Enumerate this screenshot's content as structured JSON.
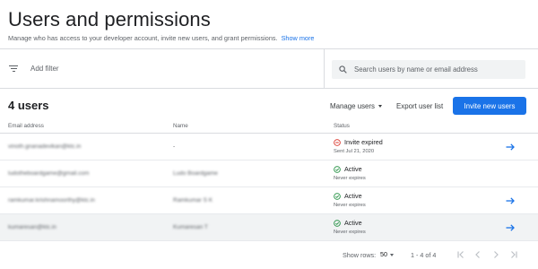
{
  "header": {
    "title": "Users and permissions",
    "subtitle": "Manage who has access to your developer account, invite new users, and grant permissions.",
    "show_more": "Show more"
  },
  "filter": {
    "label": "Add filter",
    "icon": "filter-icon"
  },
  "search": {
    "placeholder": "Search users by name or email address",
    "icon": "search-icon"
  },
  "users": {
    "count_label": "4 users",
    "manage_users": "Manage users",
    "export": "Export user list",
    "invite": "Invite new users"
  },
  "table": {
    "columns": [
      "Email address",
      "Name",
      "Status"
    ],
    "rows": [
      {
        "email": "vinoth.gnanadevikan@ktc.in",
        "name": "-",
        "name_blurred": false,
        "status": "Invite expired",
        "status_kind": "expired",
        "detail": "Sent Jul 21, 2020",
        "has_arrow": true,
        "shaded": false
      },
      {
        "email": "ludotheboardgame@gmail.com",
        "name": "Ludo Boardgame",
        "name_blurred": true,
        "status": "Active",
        "status_kind": "active",
        "detail": "Never expires",
        "has_arrow": false,
        "shaded": false
      },
      {
        "email": "ramkumar.krishnamoorthy@ktc.in",
        "name": "Ramkumar S K",
        "name_blurred": true,
        "status": "Active",
        "status_kind": "active",
        "detail": "Never expires",
        "has_arrow": true,
        "shaded": false
      },
      {
        "email": "kumaresan@ktc.in",
        "name": "Kumaresan T",
        "name_blurred": true,
        "status": "Active",
        "status_kind": "active",
        "detail": "Never expires",
        "has_arrow": true,
        "shaded": true
      }
    ]
  },
  "pagination": {
    "show_rows_label": "Show rows:",
    "rows_value": "50",
    "range": "1 - 4 of 4"
  },
  "colors": {
    "accent": "#1a73e8",
    "active": "#1e8e3e",
    "expired": "#d93025"
  }
}
